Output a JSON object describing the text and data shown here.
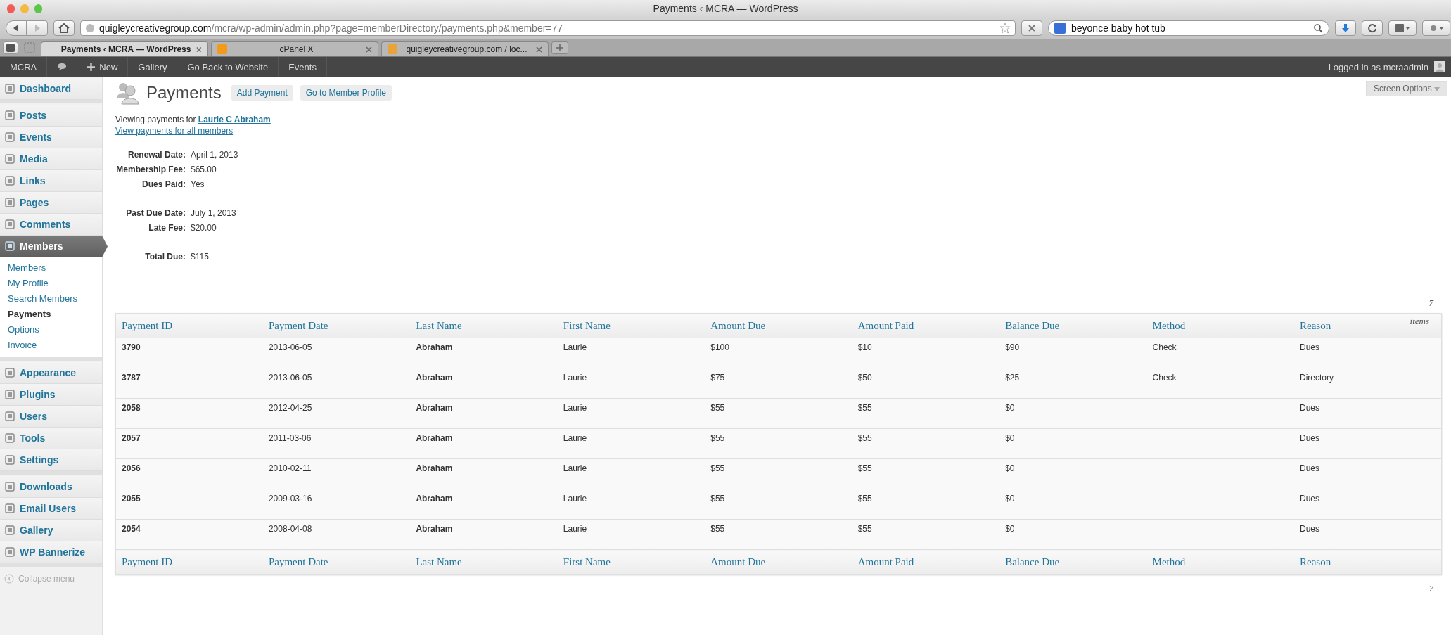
{
  "window": {
    "title": "Payments ‹ MCRA — WordPress"
  },
  "address": {
    "host": "quigleycreativegroup.com",
    "path": "/mcra/wp-admin/admin.php?page=memberDirectory/payments.php&member=77"
  },
  "search": {
    "value": "beyonce baby hot tub"
  },
  "tabs": [
    {
      "label": "Payments ‹ MCRA — WordPress",
      "selected": true
    },
    {
      "label": "cPanel X",
      "selected": false
    },
    {
      "label": "quigleycreativegroup.com / loc...",
      "selected": false
    }
  ],
  "admin_bar": {
    "items": [
      "MCRA",
      "New",
      "Gallery",
      "Go Back to Website",
      "Events"
    ],
    "account": "Logged in as mcraadmin"
  },
  "sidebar": {
    "groups": [
      {
        "items": [
          {
            "label": "Dashboard",
            "selected": false
          }
        ]
      },
      {
        "items": [
          {
            "label": "Posts",
            "selected": false
          },
          {
            "label": "Events",
            "selected": false
          },
          {
            "label": "Media",
            "selected": false
          },
          {
            "label": "Links",
            "selected": false
          },
          {
            "label": "Pages",
            "selected": false
          },
          {
            "label": "Comments",
            "selected": false
          },
          {
            "label": "Members",
            "selected": true,
            "children": [
              {
                "label": "Members",
                "selected": false
              },
              {
                "label": "My Profile",
                "selected": false
              },
              {
                "label": "Search Members",
                "selected": false
              },
              {
                "label": "Payments",
                "selected": true
              },
              {
                "label": "Options",
                "selected": false
              },
              {
                "label": "Invoice",
                "selected": false
              }
            ]
          }
        ]
      },
      {
        "items": [
          {
            "label": "Appearance",
            "selected": false
          },
          {
            "label": "Plugins",
            "selected": false
          },
          {
            "label": "Users",
            "selected": false
          },
          {
            "label": "Tools",
            "selected": false
          },
          {
            "label": "Settings",
            "selected": false
          }
        ]
      },
      {
        "items": [
          {
            "label": "Downloads",
            "selected": false
          },
          {
            "label": "Email Users",
            "selected": false
          },
          {
            "label": "Gallery",
            "selected": false
          },
          {
            "label": "WP Bannerize",
            "selected": false
          }
        ]
      }
    ],
    "collapse": "Collapse menu"
  },
  "page": {
    "title": "Payments",
    "buttons": [
      "Add Payment",
      "Go to Member Profile"
    ],
    "screen_options": "Screen Options"
  },
  "viewing": {
    "prefix": "Viewing payments for",
    "member": "Laurie C Abraham",
    "all_link": "View payments for all members"
  },
  "summary": [
    [
      {
        "label": "Renewal Date:",
        "value": "April 1, 2013"
      },
      {
        "label": "Membership Fee:",
        "value": "$65.00"
      },
      {
        "label": "Dues Paid:",
        "value": "Yes"
      }
    ],
    [
      {
        "label": "Past Due Date:",
        "value": "July 1, 2013"
      },
      {
        "label": "Late Fee:",
        "value": "$20.00"
      }
    ],
    [
      {
        "label": "Total Due:",
        "value": "$115"
      }
    ]
  ],
  "table": {
    "count": "7",
    "count_unit": "items",
    "bottom_count": "7",
    "columns": [
      "Payment ID",
      "Payment Date",
      "Last Name",
      "First Name",
      "Amount Due",
      "Amount Paid",
      "Balance Due",
      "Method",
      "Reason"
    ],
    "rows": [
      [
        "3790",
        "2013-06-05",
        "Abraham",
        "Laurie",
        "$100",
        "$10",
        "$90",
        "Check",
        "Dues"
      ],
      [
        "3787",
        "2013-06-05",
        "Abraham",
        "Laurie",
        "$75",
        "$50",
        "$25",
        "Check",
        "Directory"
      ],
      [
        "2058",
        "2012-04-25",
        "Abraham",
        "Laurie",
        "$55",
        "$55",
        "$0",
        "",
        "Dues"
      ],
      [
        "2057",
        "2011-03-06",
        "Abraham",
        "Laurie",
        "$55",
        "$55",
        "$0",
        "",
        "Dues"
      ],
      [
        "2056",
        "2010-02-11",
        "Abraham",
        "Laurie",
        "$55",
        "$55",
        "$0",
        "",
        "Dues"
      ],
      [
        "2055",
        "2009-03-16",
        "Abraham",
        "Laurie",
        "$55",
        "$55",
        "$0",
        "",
        "Dues"
      ],
      [
        "2054",
        "2008-04-08",
        "Abraham",
        "Laurie",
        "$55",
        "$55",
        "$0",
        "",
        "Dues"
      ]
    ],
    "footer_columns": [
      "Payment ID",
      "Payment Date",
      "Last Name",
      "First Name",
      "Amount Due",
      "Amount Paid",
      "Balance Due",
      "Method",
      "Reason"
    ]
  }
}
